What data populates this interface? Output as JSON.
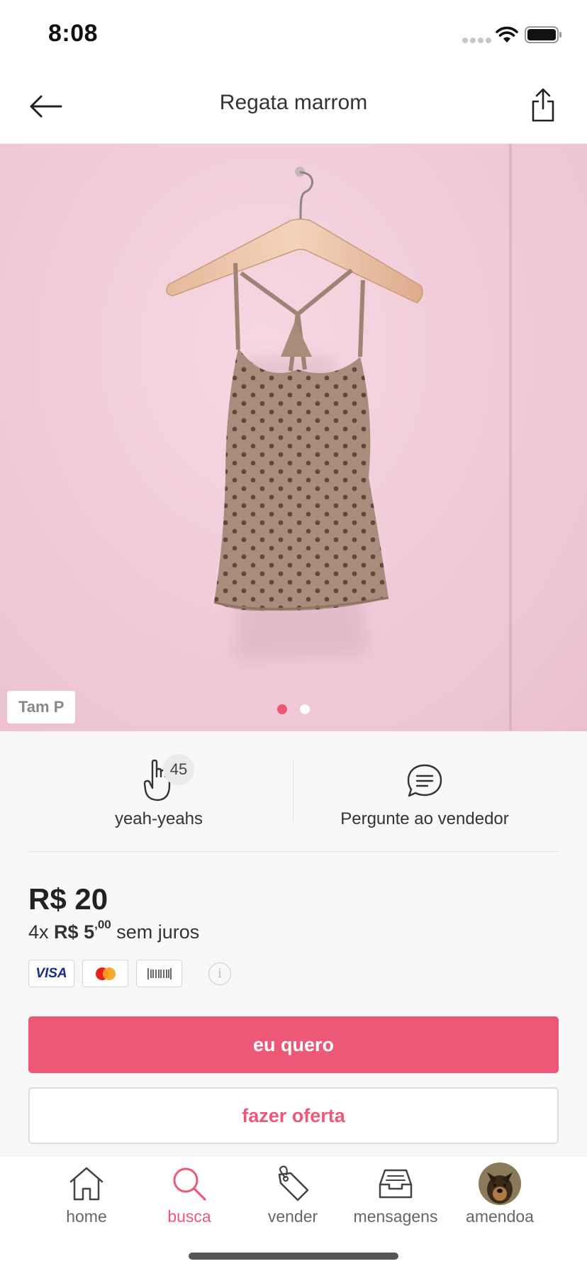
{
  "status_bar": {
    "time": "8:08"
  },
  "header": {
    "title": "Regata marrom"
  },
  "product": {
    "size_badge": "Tam P",
    "carousel": {
      "count": 2,
      "active_index": 0
    }
  },
  "actions": {
    "yeah": {
      "count": "45",
      "label": "yeah-yeahs",
      "icon": "hand-rock-icon"
    },
    "ask": {
      "label": "Pergunte ao vendedor",
      "icon": "chat-bubble-icon"
    }
  },
  "price": {
    "main": "R$ 20",
    "installments_prefix": "4x",
    "installments_value": "R$ 5",
    "installments_cents": ",00",
    "installments_suffix": "sem juros"
  },
  "payments": {
    "visa": "VISA",
    "methods": [
      "visa-card-icon",
      "mastercard-icon",
      "boleto-barcode-icon"
    ],
    "info": "i"
  },
  "buttons": {
    "primary": "eu quero",
    "secondary": "fazer oferta"
  },
  "tabs": [
    {
      "label": "home",
      "icon": "home-icon",
      "active": false
    },
    {
      "label": "busca",
      "icon": "search-icon",
      "active": true
    },
    {
      "label": "vender",
      "icon": "tag-icon",
      "active": false
    },
    {
      "label": "mensagens",
      "icon": "inbox-icon",
      "active": false
    },
    {
      "label": "amendoa",
      "icon": "avatar",
      "active": false
    }
  ],
  "colors": {
    "accent": "#ee5877",
    "text": "#222222",
    "muted": "#666666",
    "image_background": "#f1cad8"
  }
}
